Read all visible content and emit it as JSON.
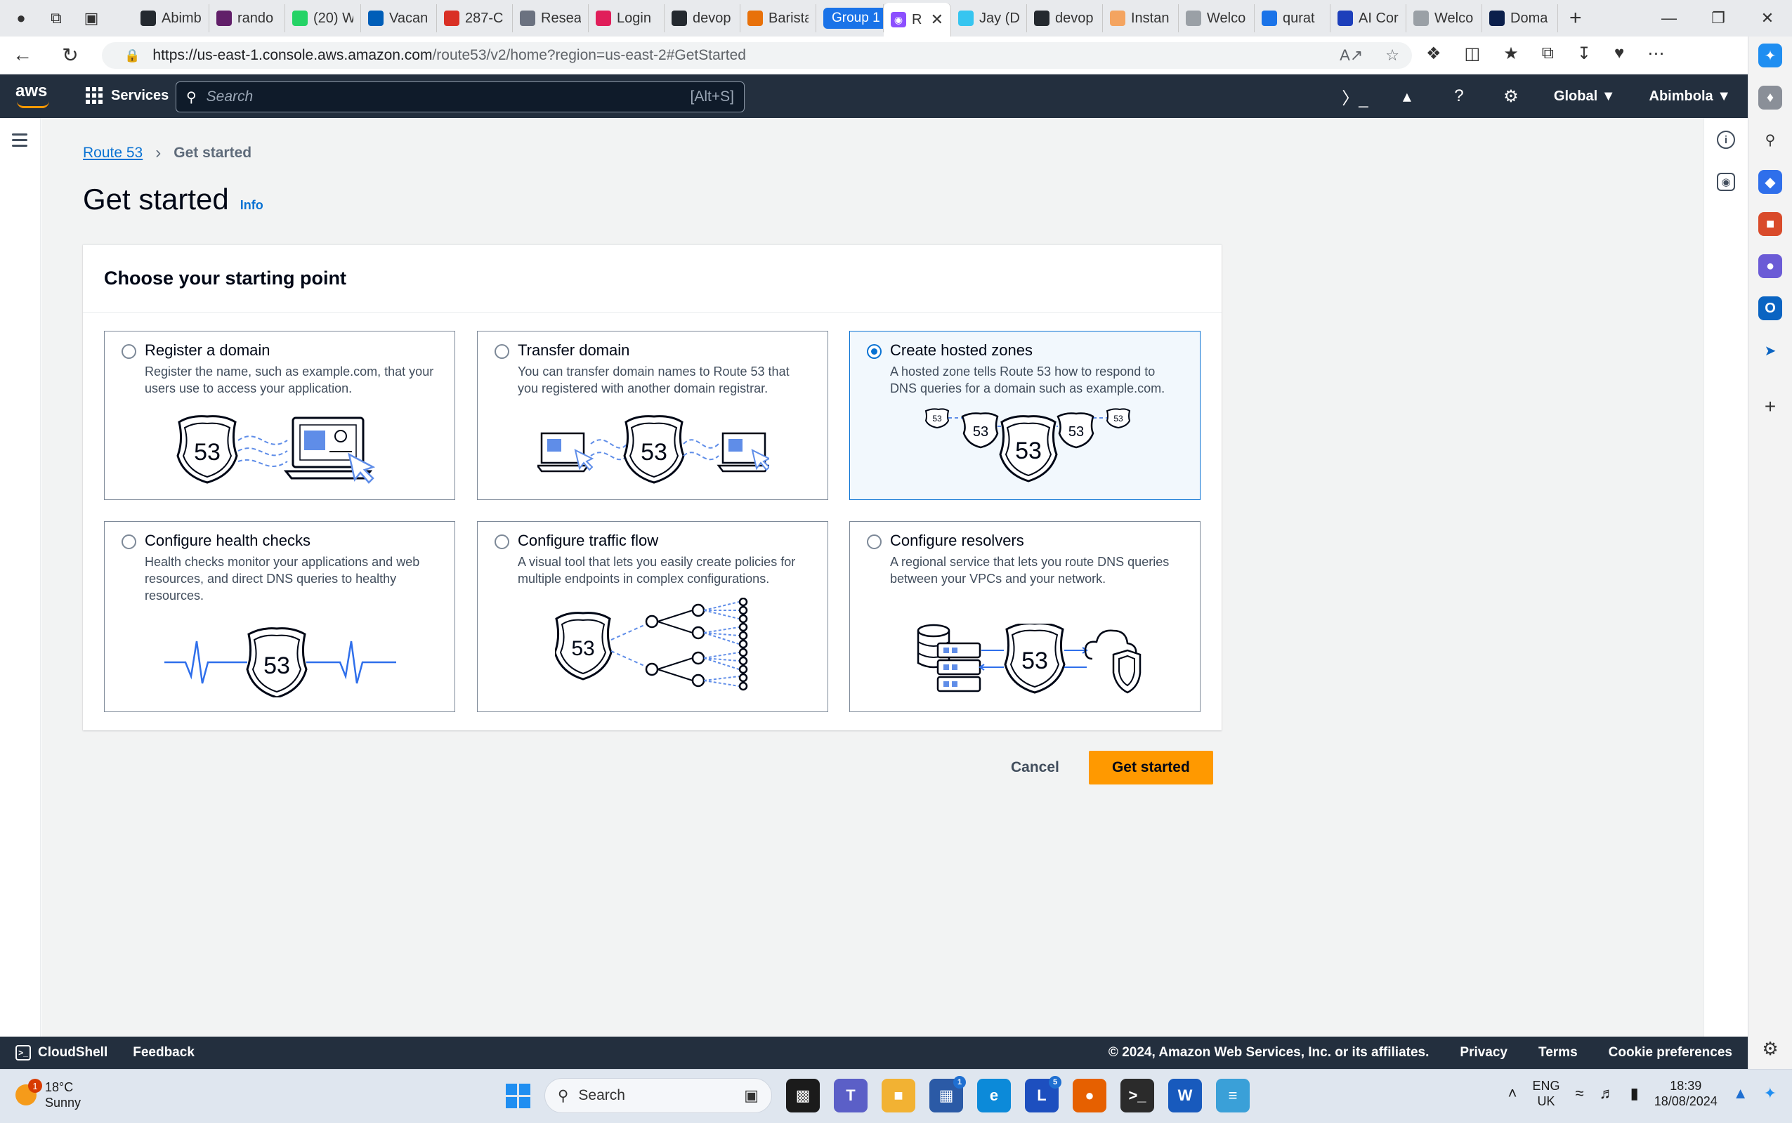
{
  "browser": {
    "tabs": [
      {
        "label": "Abimb",
        "icon": "github-icon",
        "color": "#24292f"
      },
      {
        "label": "rando",
        "icon": "slack-icon",
        "color": "#611f69"
      },
      {
        "label": "(20) W",
        "icon": "whatsapp-icon",
        "color": "#25d366"
      },
      {
        "label": "Vacan",
        "icon": "nhs-icon",
        "color": "#005eb8"
      },
      {
        "label": "287-C",
        "icon": "pdf-icon",
        "color": "#d93025"
      },
      {
        "label": "Resea",
        "icon": "research-icon",
        "color": "#6b7280"
      },
      {
        "label": "Login",
        "icon": "slack-icon",
        "color": "#e01e5a"
      },
      {
        "label": "devop",
        "icon": "github-icon",
        "color": "#24292f"
      },
      {
        "label": "Barista",
        "icon": "t-icon",
        "color": "#e8710a"
      }
    ],
    "group_label": "Group 1",
    "active_tab": {
      "label": "R",
      "icon": "route53-icon",
      "color": "#8c4fff"
    },
    "tabs_after": [
      {
        "label": "Jay (D",
        "icon": "slack-icon",
        "color": "#36c5f0"
      },
      {
        "label": "devop",
        "icon": "github-icon",
        "color": "#24292f"
      },
      {
        "label": "Instan",
        "icon": "aws-icon",
        "color": "#f4a460"
      },
      {
        "label": "Welco",
        "icon": "page-icon",
        "color": "#9aa0a6"
      },
      {
        "label": "qurat",
        "icon": "search-icon",
        "color": "#1a73e8"
      },
      {
        "label": "AI Cor",
        "icon": "q-icon",
        "color": "#1d3fbb"
      },
      {
        "label": "Welco",
        "icon": "page-icon",
        "color": "#9aa0a6"
      },
      {
        "label": "Doma",
        "icon": "n-icon",
        "color": "#0b1f4b"
      }
    ],
    "url_host": "https://us-east-1.console.aws.amazon.com",
    "url_path": "/route53/v2/home?region=us-east-2#GetStarted"
  },
  "aws_nav": {
    "logo": "aws",
    "services_label": "Services",
    "search_placeholder": "Search",
    "search_shortcut": "[Alt+S]",
    "region_label": "Global",
    "account_label": "Abimbola"
  },
  "breadcrumb": {
    "root": "Route 53",
    "current": "Get started"
  },
  "page": {
    "title": "Get started",
    "info_link": "Info"
  },
  "panel": {
    "heading": "Choose your starting point",
    "options": [
      {
        "title": "Register a domain",
        "description": "Register the name, such as example.com, that your users use to access your application.",
        "selected": false
      },
      {
        "title": "Transfer domain",
        "description": "You can transfer domain names to Route 53 that you registered with another domain registrar.",
        "selected": false
      },
      {
        "title": "Create hosted zones",
        "description": "A hosted zone tells Route 53 how to respond to DNS queries for a domain such as example.com.",
        "selected": true
      },
      {
        "title": "Configure health checks",
        "description": "Health checks monitor your applications and web resources, and direct DNS queries to healthy resources.",
        "selected": false
      },
      {
        "title": "Configure traffic flow",
        "description": "A visual tool that lets you easily create policies for multiple endpoints in complex configurations.",
        "selected": false
      },
      {
        "title": "Configure resolvers",
        "description": "A regional service that lets you route DNS queries between your VPCs and your network.",
        "selected": false
      }
    ],
    "shield_number": "53"
  },
  "actions": {
    "cancel": "Cancel",
    "primary": "Get started"
  },
  "footer": {
    "cloudshell": "CloudShell",
    "feedback": "Feedback",
    "copyright": "© 2024, Amazon Web Services, Inc. or its affiliates.",
    "privacy": "Privacy",
    "terms": "Terms",
    "cookies": "Cookie preferences"
  },
  "taskbar": {
    "weather_temp": "18°C",
    "weather_desc": "Sunny",
    "weather_badge": "1",
    "search_label": "Search",
    "lang_top": "ENG",
    "lang_bottom": "UK",
    "time": "18:39",
    "date": "18/08/2024",
    "store_badge": "1",
    "l_badge": "5"
  },
  "colors": {
    "aws_nav": "#232f3e",
    "aws_orange": "#ff9900",
    "link_blue": "#0972d3",
    "selected_tile_bg": "#f2f8fd"
  }
}
